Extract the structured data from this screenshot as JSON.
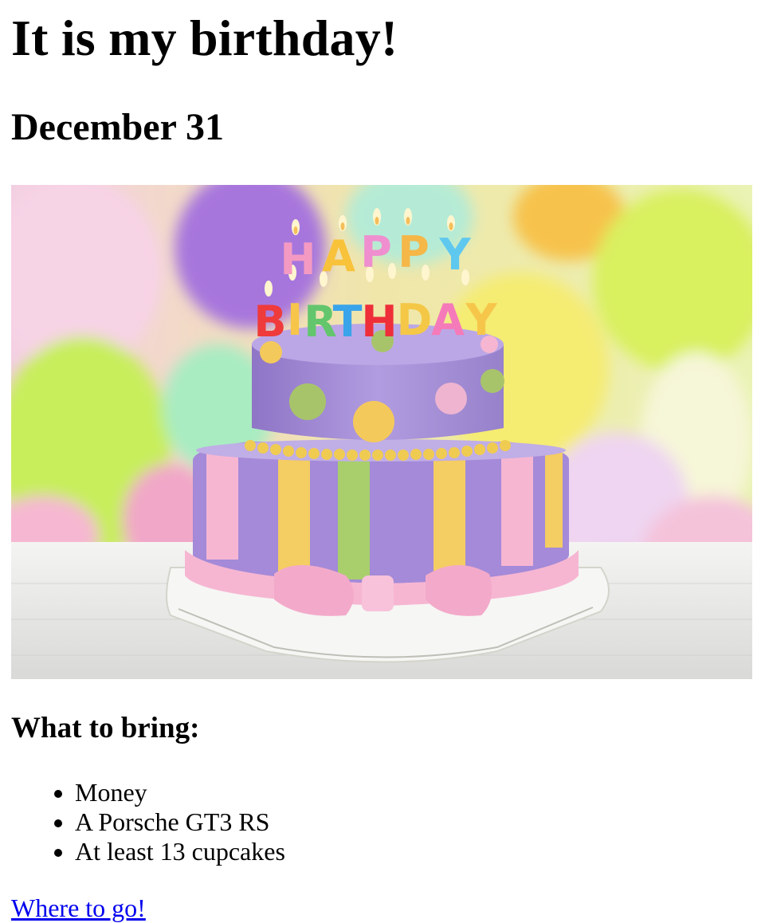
{
  "heading": "It is my birthday!",
  "date": "December 31",
  "image": {
    "banner_row1": "HAPPY",
    "banner_row2": "BIRTHDAY",
    "icon": "birthday-cake-photo"
  },
  "bring": {
    "heading": "What to bring:",
    "items": [
      "Money",
      "A Porsche GT3 RS",
      "At least 13 cupcakes"
    ]
  },
  "link": "Where to go!",
  "colors": {
    "link": "#0000ee",
    "cake_purple": "#a48ad8",
    "ribbon_pink": "#f6b6d2",
    "stripe_yellow": "#f4cd63",
    "stripe_green": "#a8cf6c"
  }
}
